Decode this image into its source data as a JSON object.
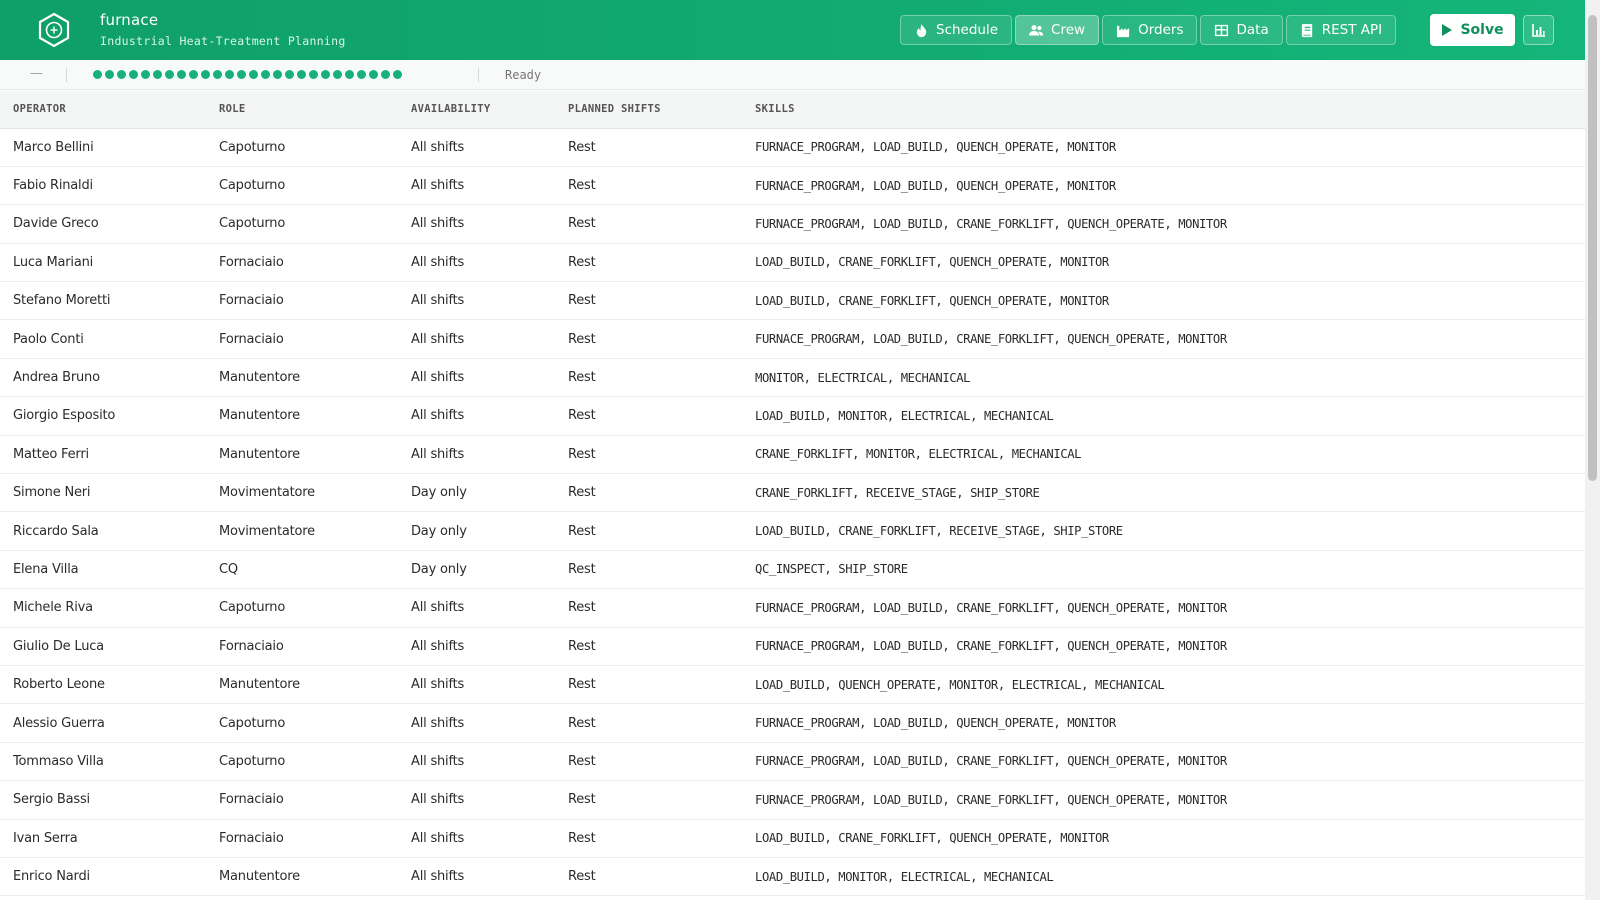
{
  "app": {
    "title": "furnace",
    "subtitle": "Industrial Heat-Treatment Planning",
    "brand_color": "#12a870"
  },
  "nav": [
    {
      "label": "Schedule",
      "icon": "flame-icon",
      "active": false
    },
    {
      "label": "Crew",
      "icon": "users-icon",
      "active": true
    },
    {
      "label": "Orders",
      "icon": "factory-icon",
      "active": false
    },
    {
      "label": "Data",
      "icon": "table-icon",
      "active": false
    },
    {
      "label": "REST API",
      "icon": "book-icon",
      "active": false
    }
  ],
  "actions": {
    "solve_label": "Solve",
    "analytics_icon": "chart-icon"
  },
  "status": {
    "score": "—",
    "progress_dots": 26,
    "text": "Ready"
  },
  "table": {
    "columns": [
      "OPERATOR",
      "ROLE",
      "AVAILABILITY",
      "PLANNED SHIFTS",
      "SKILLS"
    ],
    "rows": [
      [
        "Marco Bellini",
        "Capoturno",
        "All shifts",
        "Rest",
        "FURNACE_PROGRAM, LOAD_BUILD, QUENCH_OPERATE, MONITOR"
      ],
      [
        "Fabio Rinaldi",
        "Capoturno",
        "All shifts",
        "Rest",
        "FURNACE_PROGRAM, LOAD_BUILD, QUENCH_OPERATE, MONITOR"
      ],
      [
        "Davide Greco",
        "Capoturno",
        "All shifts",
        "Rest",
        "FURNACE_PROGRAM, LOAD_BUILD, CRANE_FORKLIFT, QUENCH_OPERATE, MONITOR"
      ],
      [
        "Luca Mariani",
        "Fornaciaio",
        "All shifts",
        "Rest",
        "LOAD_BUILD, CRANE_FORKLIFT, QUENCH_OPERATE, MONITOR"
      ],
      [
        "Stefano Moretti",
        "Fornaciaio",
        "All shifts",
        "Rest",
        "LOAD_BUILD, CRANE_FORKLIFT, QUENCH_OPERATE, MONITOR"
      ],
      [
        "Paolo Conti",
        "Fornaciaio",
        "All shifts",
        "Rest",
        "FURNACE_PROGRAM, LOAD_BUILD, CRANE_FORKLIFT, QUENCH_OPERATE, MONITOR"
      ],
      [
        "Andrea Bruno",
        "Manutentore",
        "All shifts",
        "Rest",
        "MONITOR, ELECTRICAL, MECHANICAL"
      ],
      [
        "Giorgio Esposito",
        "Manutentore",
        "All shifts",
        "Rest",
        "LOAD_BUILD, MONITOR, ELECTRICAL, MECHANICAL"
      ],
      [
        "Matteo Ferri",
        "Manutentore",
        "All shifts",
        "Rest",
        "CRANE_FORKLIFT, MONITOR, ELECTRICAL, MECHANICAL"
      ],
      [
        "Simone Neri",
        "Movimentatore",
        "Day only",
        "Rest",
        "CRANE_FORKLIFT, RECEIVE_STAGE, SHIP_STORE"
      ],
      [
        "Riccardo Sala",
        "Movimentatore",
        "Day only",
        "Rest",
        "LOAD_BUILD, CRANE_FORKLIFT, RECEIVE_STAGE, SHIP_STORE"
      ],
      [
        "Elena Villa",
        "CQ",
        "Day only",
        "Rest",
        "QC_INSPECT, SHIP_STORE"
      ],
      [
        "Michele Riva",
        "Capoturno",
        "All shifts",
        "Rest",
        "FURNACE_PROGRAM, LOAD_BUILD, CRANE_FORKLIFT, QUENCH_OPERATE, MONITOR"
      ],
      [
        "Giulio De Luca",
        "Fornaciaio",
        "All shifts",
        "Rest",
        "FURNACE_PROGRAM, LOAD_BUILD, CRANE_FORKLIFT, QUENCH_OPERATE, MONITOR"
      ],
      [
        "Roberto Leone",
        "Manutentore",
        "All shifts",
        "Rest",
        "LOAD_BUILD, QUENCH_OPERATE, MONITOR, ELECTRICAL, MECHANICAL"
      ],
      [
        "Alessio Guerra",
        "Capoturno",
        "All shifts",
        "Rest",
        "FURNACE_PROGRAM, LOAD_BUILD, QUENCH_OPERATE, MONITOR"
      ],
      [
        "Tommaso Villa",
        "Capoturno",
        "All shifts",
        "Rest",
        "FURNACE_PROGRAM, LOAD_BUILD, CRANE_FORKLIFT, QUENCH_OPERATE, MONITOR"
      ],
      [
        "Sergio Bassi",
        "Fornaciaio",
        "All shifts",
        "Rest",
        "FURNACE_PROGRAM, LOAD_BUILD, CRANE_FORKLIFT, QUENCH_OPERATE, MONITOR"
      ],
      [
        "Ivan Serra",
        "Fornaciaio",
        "All shifts",
        "Rest",
        "LOAD_BUILD, CRANE_FORKLIFT, QUENCH_OPERATE, MONITOR"
      ],
      [
        "Enrico Nardi",
        "Manutentore",
        "All shifts",
        "Rest",
        "LOAD_BUILD, MONITOR, ELECTRICAL, MECHANICAL"
      ]
    ]
  }
}
